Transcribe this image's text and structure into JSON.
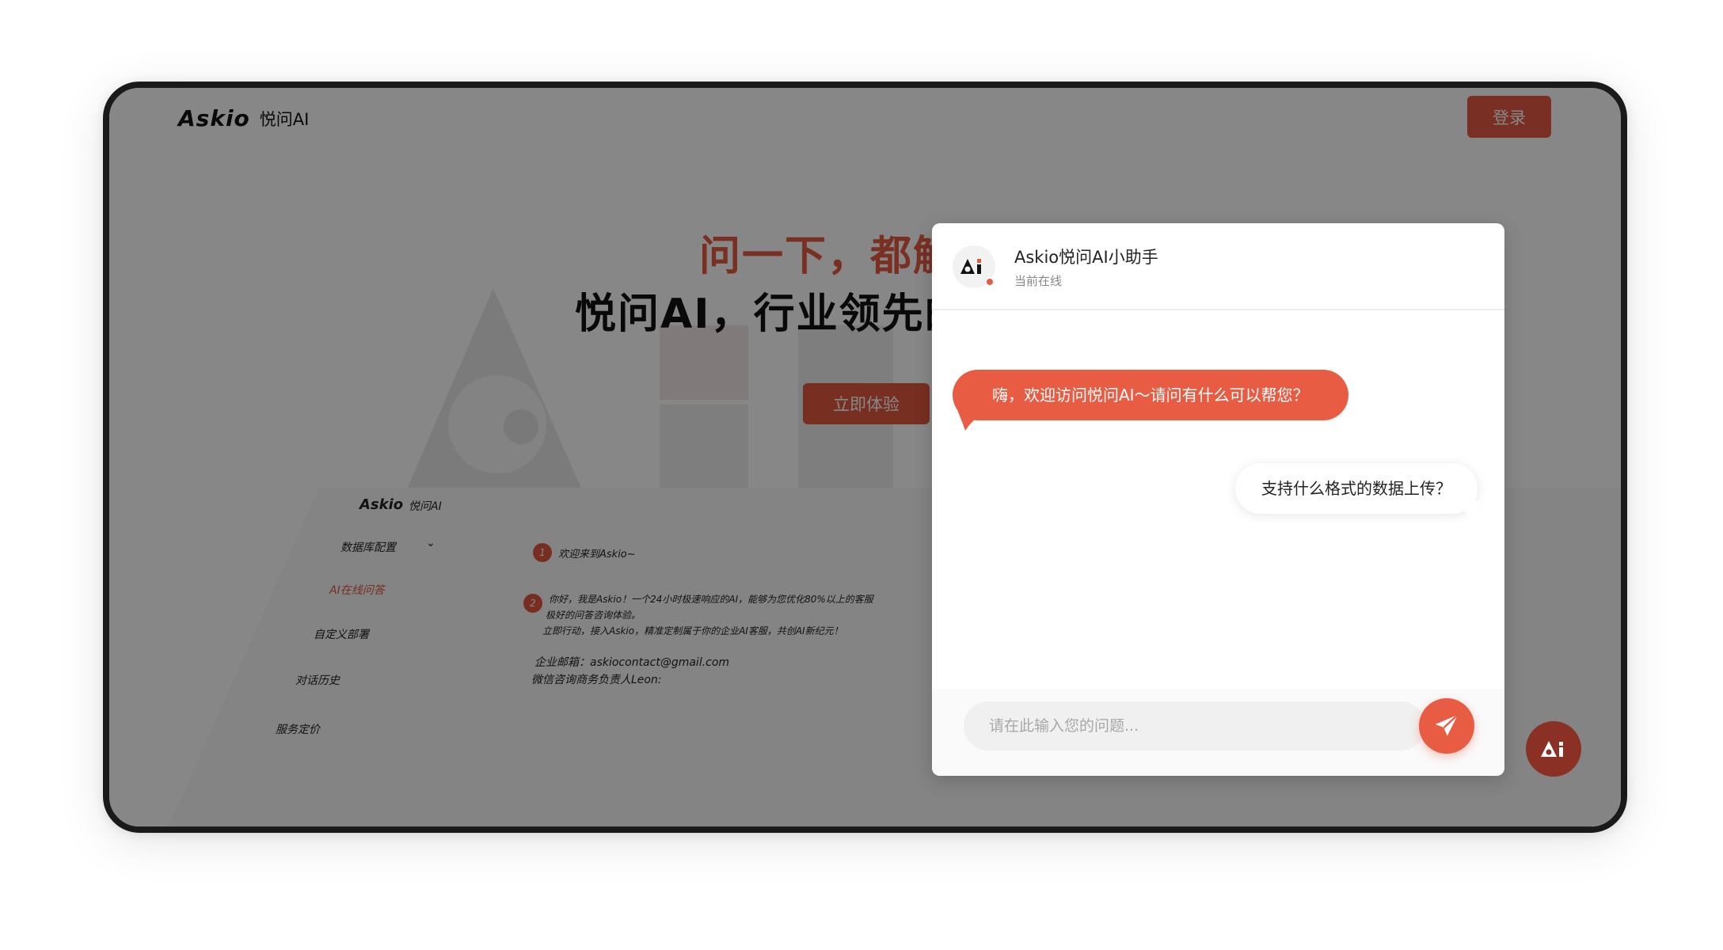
{
  "nav": {
    "logo_mark": "Askio",
    "logo_name": "悦问AI",
    "login_label": "登录"
  },
  "hero": {
    "line1": "问一下，都解",
    "line2": "悦问AI，行业领先的",
    "cta_label": "立即体验"
  },
  "preview": {
    "logo_mark": "Askio",
    "logo_name": "悦问AI",
    "menu": [
      {
        "label": "数据库配置"
      },
      {
        "label": "AI在线问答"
      },
      {
        "label": "自定义部署"
      },
      {
        "label": "对话历史"
      },
      {
        "label": "服务定价"
      }
    ],
    "step1_num": "1",
    "step1_text": "欢迎来到Askio~",
    "step2_num": "2",
    "step2_line1": "你好，我是Askio！一个24小时极速响应的AI，能够为您优化80%以上的客服",
    "step2_line2": "极好的问答咨询体验。",
    "step2_line3": "立即行动，接入Askio，精准定制属于你的企业AI客服，共创AI新纪元！",
    "email_line": "企业邮箱：askiocontact@gmail.com",
    "wechat_line": "微信咨询商务负责人Leon:"
  },
  "chat": {
    "bot_name": "Askio悦问AI小助手",
    "bot_status": "当前在线",
    "messages": [
      {
        "from": "bot",
        "text": "嗨，欢迎访问悦问AI～请问有什么可以帮您？"
      },
      {
        "from": "user",
        "text": "支持什么格式的数据上传？"
      }
    ],
    "input_placeholder": "请在此输入您的问题...",
    "send_icon": "paper-plane-icon"
  },
  "colors": {
    "accent": "#e85c43",
    "overlay": "rgba(0,0,0,0.47)",
    "frame": "#1a1a1a"
  }
}
